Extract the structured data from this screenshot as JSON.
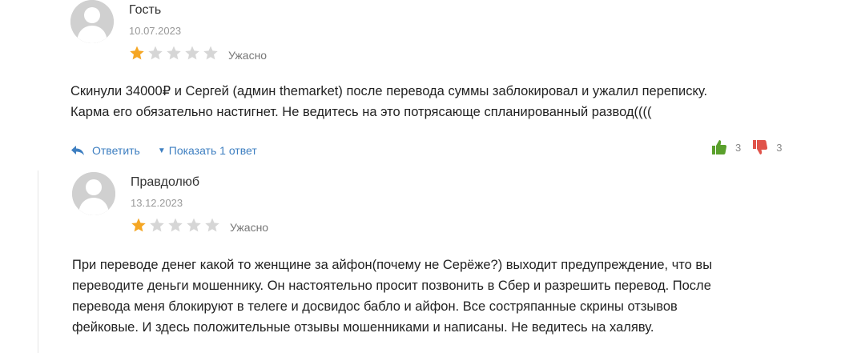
{
  "reviews": [
    {
      "author": "Гость",
      "date": "10.07.2023",
      "rating": 1,
      "rating_max": 5,
      "rating_label": "Ужасно",
      "text_lines": [
        "Скинули 34000₽ и Сергей (админ themarket) после перевода суммы заблокировал и ужалил переписку.",
        "Карма его обязательно настигнет. Не ведитесь на это потрясающе спланированный развод(((("
      ],
      "reply_label": "Ответить",
      "show_replies_label": "Показать 1 ответ",
      "likes": "3",
      "dislikes": "3"
    },
    {
      "author": "Правдолюб",
      "date": "13.12.2023",
      "rating": 1,
      "rating_max": 5,
      "rating_label": "Ужасно",
      "text_lines": [
        "При переводе денег какой то женщине за айфон(почему не Серёже?) выходит предупреждение, что вы",
        "переводите деньги мошеннику. Он настоятельно просит позвонить в Сбер и разрешить перевод. После",
        "перевода меня блокируют в телеге и досвидос бабло и айфон. Все состряпанные скрины отзывов",
        "фейковые. И здесь положительные отзывы мошенниками и написаны. Не ведитесь на халяву."
      ]
    }
  ],
  "icons": {
    "avatar": "user-silhouette-icon",
    "star_filled": "star-filled-icon",
    "star_empty": "star-empty-icon",
    "reply": "reply-arrow-icon",
    "caret": "caret-down-icon",
    "like": "thumbs-up-icon",
    "dislike": "thumbs-down-icon"
  },
  "colors": {
    "star_filled": "#f5a623",
    "star_empty": "#d6d6d6",
    "link": "#3e7fc1",
    "like": "#5aa02c",
    "dislike": "#e0534a"
  }
}
